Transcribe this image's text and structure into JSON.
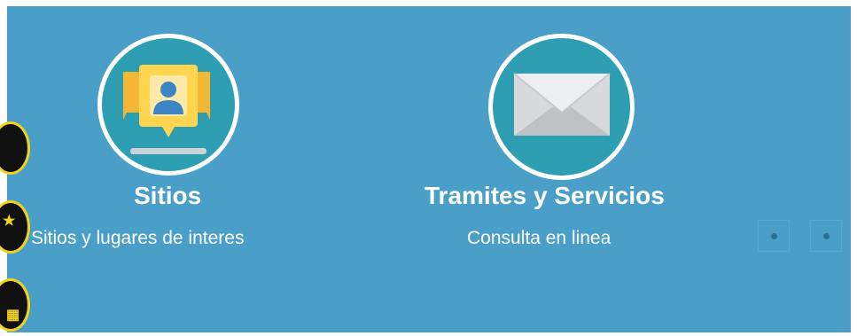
{
  "cards": [
    {
      "title": "Sitios",
      "subtitle": "Sitios y lugares de interes",
      "icon": "location-person-icon"
    },
    {
      "title": "Tramites y Servicios",
      "subtitle": "Consulta en linea",
      "icon": "envelope-icon"
    }
  ],
  "side_buttons": [
    {
      "icon": "accessibility-icon"
    },
    {
      "icon": "star-icon"
    },
    {
      "icon": "text-size-icon"
    }
  ],
  "carousel_dots": [
    {
      "label": ""
    },
    {
      "label": ""
    }
  ],
  "colors": {
    "panel": "#4a9fc8",
    "circle": "#2e9fb2",
    "text": "#ffffff",
    "side_button_border": "#f2d21a"
  }
}
